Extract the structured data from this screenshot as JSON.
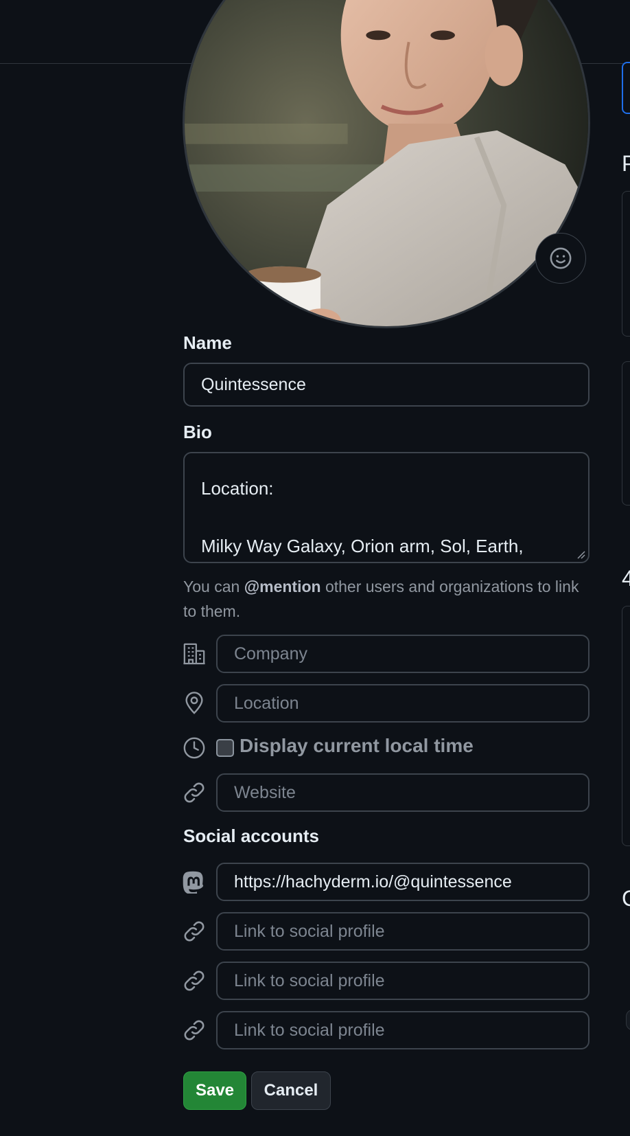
{
  "avatar": {
    "alt": "Profile picture",
    "emoji_button": "smiley-icon"
  },
  "name": {
    "label": "Name",
    "value": "Quintessence"
  },
  "bio": {
    "label": "Bio",
    "lines": [
      "Location:",
      "Milky Way Galaxy, Orion arm, Sol, Earth,"
    ]
  },
  "hint": {
    "prefix": "You can ",
    "mention": "@mention",
    "suffix": " other users and organizations to link to them."
  },
  "company": {
    "placeholder": "Company",
    "icon": "organization-icon"
  },
  "location": {
    "placeholder": "Location",
    "icon": "location-icon"
  },
  "local_time": {
    "label": "Display current local time",
    "checked": false,
    "icon": "clock-icon"
  },
  "website": {
    "placeholder": "Website",
    "icon": "link-icon"
  },
  "social": {
    "label": "Social accounts",
    "accounts": [
      {
        "value": "https://hachyderm.io/@quintessence",
        "placeholder": "Link to social profile",
        "icon": "mastodon-icon"
      },
      {
        "value": "",
        "placeholder": "Link to social profile",
        "icon": "link-icon"
      },
      {
        "value": "",
        "placeholder": "Link to social profile",
        "icon": "link-icon"
      },
      {
        "value": "",
        "placeholder": "Link to social profile",
        "icon": "link-icon"
      }
    ]
  },
  "actions": {
    "save": "Save",
    "cancel": "Cancel"
  },
  "colors": {
    "background": "#0d1117",
    "border": "#3d444d",
    "save_green": "#238636",
    "text": "#e6edf3",
    "muted": "#9198a1"
  }
}
